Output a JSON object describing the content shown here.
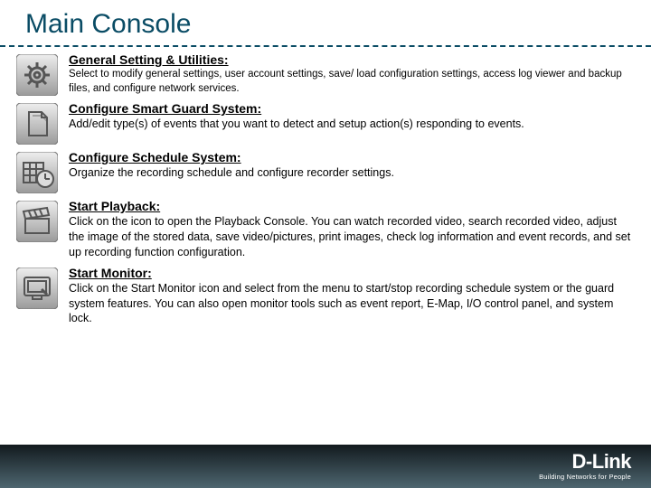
{
  "title": "Main Console",
  "items": [
    {
      "heading": "General Setting & Utilities:",
      "desc": "Select to modify general settings, user account settings, save/ load configuration settings, access log viewer and backup files, and configure network services.",
      "icon": "gear-icon",
      "small": true
    },
    {
      "heading": "Configure Smart Guard System:",
      "desc": "Add/edit type(s) of events that you want to detect and setup action(s) responding to events.",
      "icon": "document-icon",
      "small": false
    },
    {
      "heading": "Configure Schedule System:",
      "desc": "Organize the recording schedule and configure recorder settings.",
      "icon": "schedule-icon",
      "small": false
    },
    {
      "heading": "Start Playback:",
      "desc": "Click on the icon to open the Playback Console. You can watch recorded video, search recorded video, adjust the image of the stored data, save video/pictures, print images, check log information and event records, and set up recording function configuration.",
      "icon": "clapper-icon",
      "small": false
    },
    {
      "heading": "Start Monitor:",
      "desc": "Click on the Start Monitor icon and select from the menu to start/stop recording schedule system or the guard system features. You can also open monitor tools such as event report, E-Map, I/O control panel, and system lock.",
      "icon": "monitor-icon",
      "small": false
    }
  ],
  "footer": {
    "brand": "D-Link",
    "tagline": "Building Networks for People"
  }
}
